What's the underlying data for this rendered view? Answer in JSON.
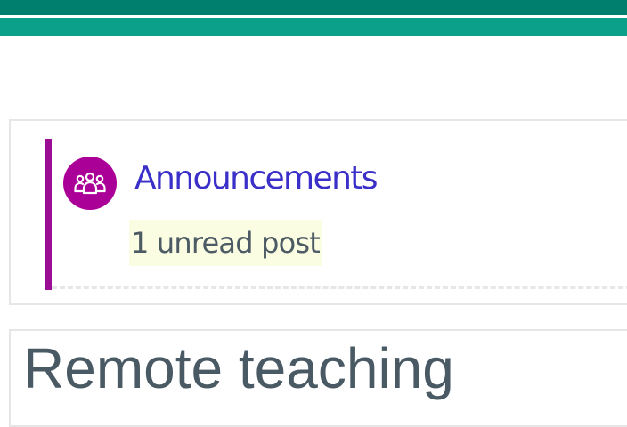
{
  "header": {
    "primary_color": "#007e6e",
    "secondary_color": "#0aa08a"
  },
  "activity": {
    "icon": "forum-people-icon",
    "icon_color": "#ab0097",
    "accent_color": "#9b0d95",
    "name": "Announcements",
    "unread_label": "1 unread post"
  },
  "next_section": {
    "title": "Remote teaching"
  }
}
